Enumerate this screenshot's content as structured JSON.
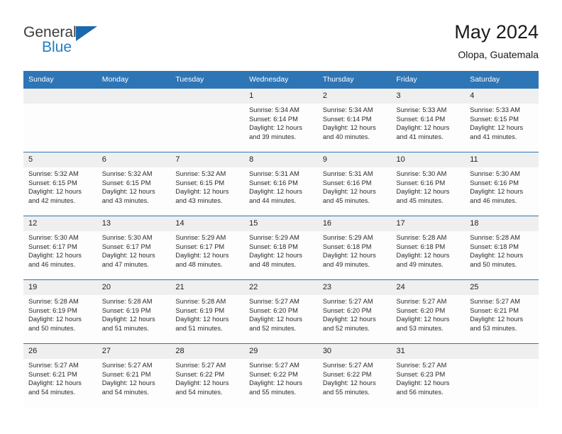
{
  "brand": {
    "name_top": "General",
    "name_bottom": "Blue",
    "accent_color": "#1f7fc4",
    "triangle_color": "#1b68ae"
  },
  "header": {
    "title": "May 2024",
    "subtitle": "Olopa, Guatemala",
    "header_bg": "#2e75b6",
    "daynum_bg": "#efefef"
  },
  "weekday_headers": [
    "Sunday",
    "Monday",
    "Tuesday",
    "Wednesday",
    "Thursday",
    "Friday",
    "Saturday"
  ],
  "labels": {
    "sunrise_prefix": "Sunrise:",
    "sunset_prefix": "Sunset:",
    "daylight_prefix": "Daylight:"
  },
  "weeks": [
    [
      {
        "day": "",
        "empty": true
      },
      {
        "day": "",
        "empty": true
      },
      {
        "day": "",
        "empty": true
      },
      {
        "day": "1",
        "sunrise": "Sunrise: 5:34 AM",
        "sunset": "Sunset: 6:14 PM",
        "daylight1": "Daylight: 12 hours",
        "daylight2": "and 39 minutes."
      },
      {
        "day": "2",
        "sunrise": "Sunrise: 5:34 AM",
        "sunset": "Sunset: 6:14 PM",
        "daylight1": "Daylight: 12 hours",
        "daylight2": "and 40 minutes."
      },
      {
        "day": "3",
        "sunrise": "Sunrise: 5:33 AM",
        "sunset": "Sunset: 6:14 PM",
        "daylight1": "Daylight: 12 hours",
        "daylight2": "and 41 minutes."
      },
      {
        "day": "4",
        "sunrise": "Sunrise: 5:33 AM",
        "sunset": "Sunset: 6:15 PM",
        "daylight1": "Daylight: 12 hours",
        "daylight2": "and 41 minutes."
      }
    ],
    [
      {
        "day": "5",
        "sunrise": "Sunrise: 5:32 AM",
        "sunset": "Sunset: 6:15 PM",
        "daylight1": "Daylight: 12 hours",
        "daylight2": "and 42 minutes."
      },
      {
        "day": "6",
        "sunrise": "Sunrise: 5:32 AM",
        "sunset": "Sunset: 6:15 PM",
        "daylight1": "Daylight: 12 hours",
        "daylight2": "and 43 minutes."
      },
      {
        "day": "7",
        "sunrise": "Sunrise: 5:32 AM",
        "sunset": "Sunset: 6:15 PM",
        "daylight1": "Daylight: 12 hours",
        "daylight2": "and 43 minutes."
      },
      {
        "day": "8",
        "sunrise": "Sunrise: 5:31 AM",
        "sunset": "Sunset: 6:16 PM",
        "daylight1": "Daylight: 12 hours",
        "daylight2": "and 44 minutes."
      },
      {
        "day": "9",
        "sunrise": "Sunrise: 5:31 AM",
        "sunset": "Sunset: 6:16 PM",
        "daylight1": "Daylight: 12 hours",
        "daylight2": "and 45 minutes."
      },
      {
        "day": "10",
        "sunrise": "Sunrise: 5:30 AM",
        "sunset": "Sunset: 6:16 PM",
        "daylight1": "Daylight: 12 hours",
        "daylight2": "and 45 minutes."
      },
      {
        "day": "11",
        "sunrise": "Sunrise: 5:30 AM",
        "sunset": "Sunset: 6:16 PM",
        "daylight1": "Daylight: 12 hours",
        "daylight2": "and 46 minutes."
      }
    ],
    [
      {
        "day": "12",
        "sunrise": "Sunrise: 5:30 AM",
        "sunset": "Sunset: 6:17 PM",
        "daylight1": "Daylight: 12 hours",
        "daylight2": "and 46 minutes."
      },
      {
        "day": "13",
        "sunrise": "Sunrise: 5:30 AM",
        "sunset": "Sunset: 6:17 PM",
        "daylight1": "Daylight: 12 hours",
        "daylight2": "and 47 minutes."
      },
      {
        "day": "14",
        "sunrise": "Sunrise: 5:29 AM",
        "sunset": "Sunset: 6:17 PM",
        "daylight1": "Daylight: 12 hours",
        "daylight2": "and 48 minutes."
      },
      {
        "day": "15",
        "sunrise": "Sunrise: 5:29 AM",
        "sunset": "Sunset: 6:18 PM",
        "daylight1": "Daylight: 12 hours",
        "daylight2": "and 48 minutes."
      },
      {
        "day": "16",
        "sunrise": "Sunrise: 5:29 AM",
        "sunset": "Sunset: 6:18 PM",
        "daylight1": "Daylight: 12 hours",
        "daylight2": "and 49 minutes."
      },
      {
        "day": "17",
        "sunrise": "Sunrise: 5:28 AM",
        "sunset": "Sunset: 6:18 PM",
        "daylight1": "Daylight: 12 hours",
        "daylight2": "and 49 minutes."
      },
      {
        "day": "18",
        "sunrise": "Sunrise: 5:28 AM",
        "sunset": "Sunset: 6:18 PM",
        "daylight1": "Daylight: 12 hours",
        "daylight2": "and 50 minutes."
      }
    ],
    [
      {
        "day": "19",
        "sunrise": "Sunrise: 5:28 AM",
        "sunset": "Sunset: 6:19 PM",
        "daylight1": "Daylight: 12 hours",
        "daylight2": "and 50 minutes."
      },
      {
        "day": "20",
        "sunrise": "Sunrise: 5:28 AM",
        "sunset": "Sunset: 6:19 PM",
        "daylight1": "Daylight: 12 hours",
        "daylight2": "and 51 minutes."
      },
      {
        "day": "21",
        "sunrise": "Sunrise: 5:28 AM",
        "sunset": "Sunset: 6:19 PM",
        "daylight1": "Daylight: 12 hours",
        "daylight2": "and 51 minutes."
      },
      {
        "day": "22",
        "sunrise": "Sunrise: 5:27 AM",
        "sunset": "Sunset: 6:20 PM",
        "daylight1": "Daylight: 12 hours",
        "daylight2": "and 52 minutes."
      },
      {
        "day": "23",
        "sunrise": "Sunrise: 5:27 AM",
        "sunset": "Sunset: 6:20 PM",
        "daylight1": "Daylight: 12 hours",
        "daylight2": "and 52 minutes."
      },
      {
        "day": "24",
        "sunrise": "Sunrise: 5:27 AM",
        "sunset": "Sunset: 6:20 PM",
        "daylight1": "Daylight: 12 hours",
        "daylight2": "and 53 minutes."
      },
      {
        "day": "25",
        "sunrise": "Sunrise: 5:27 AM",
        "sunset": "Sunset: 6:21 PM",
        "daylight1": "Daylight: 12 hours",
        "daylight2": "and 53 minutes."
      }
    ],
    [
      {
        "day": "26",
        "sunrise": "Sunrise: 5:27 AM",
        "sunset": "Sunset: 6:21 PM",
        "daylight1": "Daylight: 12 hours",
        "daylight2": "and 54 minutes."
      },
      {
        "day": "27",
        "sunrise": "Sunrise: 5:27 AM",
        "sunset": "Sunset: 6:21 PM",
        "daylight1": "Daylight: 12 hours",
        "daylight2": "and 54 minutes."
      },
      {
        "day": "28",
        "sunrise": "Sunrise: 5:27 AM",
        "sunset": "Sunset: 6:22 PM",
        "daylight1": "Daylight: 12 hours",
        "daylight2": "and 54 minutes."
      },
      {
        "day": "29",
        "sunrise": "Sunrise: 5:27 AM",
        "sunset": "Sunset: 6:22 PM",
        "daylight1": "Daylight: 12 hours",
        "daylight2": "and 55 minutes."
      },
      {
        "day": "30",
        "sunrise": "Sunrise: 5:27 AM",
        "sunset": "Sunset: 6:22 PM",
        "daylight1": "Daylight: 12 hours",
        "daylight2": "and 55 minutes."
      },
      {
        "day": "31",
        "sunrise": "Sunrise: 5:27 AM",
        "sunset": "Sunset: 6:23 PM",
        "daylight1": "Daylight: 12 hours",
        "daylight2": "and 56 minutes."
      },
      {
        "day": "",
        "empty": true
      }
    ]
  ]
}
